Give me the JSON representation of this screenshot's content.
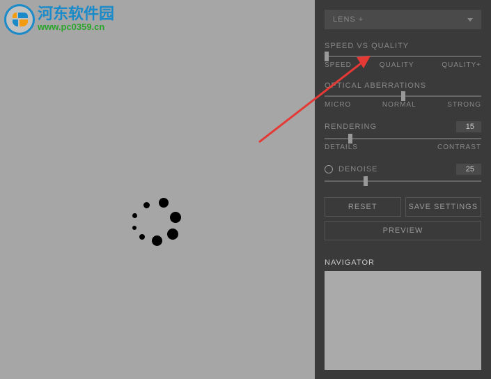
{
  "watermark": {
    "cn_text": "河东软件园",
    "url_text": "www.pc0359.cn"
  },
  "dropdown": {
    "label": "LENS +"
  },
  "speed_quality": {
    "title": "SPEED VS QUALITY",
    "left": "SPEED",
    "mid": "QUALITY",
    "right": "QUALITY+"
  },
  "optical": {
    "title": "OPTICAL ABERRATIONS",
    "left": "MICRO",
    "mid": "NORMAL",
    "right": "STRONG"
  },
  "rendering": {
    "title": "RENDERING",
    "value": "15",
    "left": "DETAILS",
    "right": "CONTRAST"
  },
  "denoise": {
    "title": "DENOISE",
    "value": "25"
  },
  "buttons": {
    "reset": "RESET",
    "save": "SAVE SETTINGS",
    "preview": "PREVIEW"
  },
  "navigator": {
    "title": "NAVIGATOR"
  }
}
